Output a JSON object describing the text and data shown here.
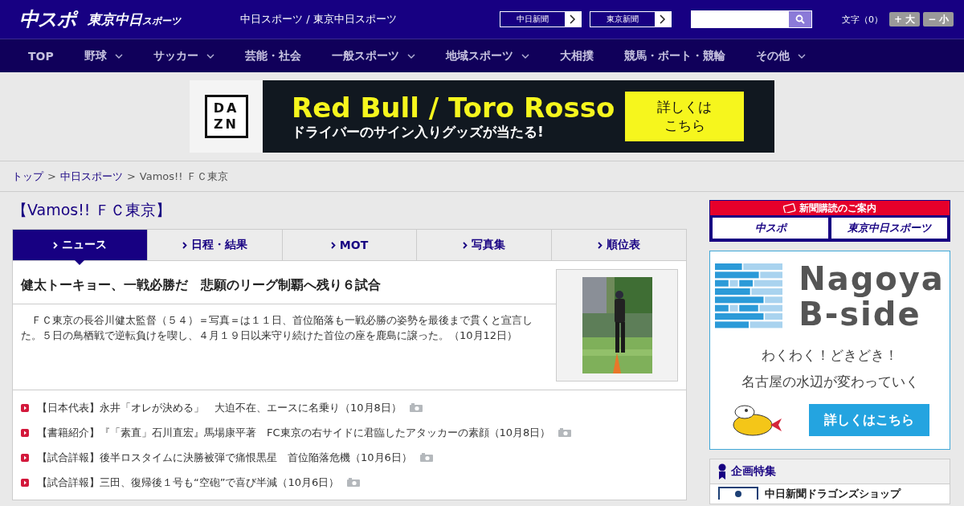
{
  "header": {
    "logo": "中スポ",
    "logo2": "東京中日",
    "logo2_small": "スポーツ",
    "site_title": "中日スポーツ / 東京中日スポーツ",
    "paper_links": [
      {
        "label": "中日新聞"
      },
      {
        "label": "東京新聞"
      }
    ],
    "font_size": {
      "label": "文字（0）",
      "buttons": [
        "+ 大",
        "− 小"
      ]
    }
  },
  "nav": [
    {
      "label": "TOP",
      "has_menu": false
    },
    {
      "label": "野球",
      "has_menu": true
    },
    {
      "label": "サッカー",
      "has_menu": true
    },
    {
      "label": "芸能・社会",
      "has_menu": false
    },
    {
      "label": "一般スポーツ",
      "has_menu": true
    },
    {
      "label": "地域スポーツ",
      "has_menu": true
    },
    {
      "label": "大相撲",
      "has_menu": false
    },
    {
      "label": "競馬・ボート・競輪",
      "has_menu": false
    },
    {
      "label": "その他",
      "has_menu": true
    }
  ],
  "ad_banner": {
    "logo_lines": [
      "DA",
      "ZN"
    ],
    "headline": "Red Bull / Toro Rosso",
    "subline": "ドライバーのサイン入りグッズが当たる!",
    "cta_lines": [
      "詳しくは",
      "こちら"
    ]
  },
  "breadcrumb": [
    {
      "kind": "link",
      "label": "トップ"
    },
    {
      "kind": "separator",
      "label": ">"
    },
    {
      "kind": "link",
      "label": "中日スポーツ"
    },
    {
      "kind": "separator",
      "label": ">"
    },
    {
      "kind": "current",
      "label": "Vamos!!  ＦＣ東京"
    }
  ],
  "page_title": "【Vamos!!  ＦＣ東京】",
  "tabs": [
    {
      "label": "ニュース",
      "selected": true
    },
    {
      "label": "日程・結果",
      "selected": false
    },
    {
      "label": "MOT",
      "selected": false
    },
    {
      "label": "写真集",
      "selected": false
    },
    {
      "label": "順位表",
      "selected": false
    }
  ],
  "article": {
    "headline": "健太トーキョー、一戦必勝だ　悲願のリーグ制覇へ残り６試合",
    "body": "　ＦＣ東京の長谷川健太監督（５４）＝写真＝は１１日、首位陥落も一戦必勝の姿勢を最後まで貫くと宣言した。５日の鳥栖戦で逆転負けを喫し、４月１９日以来守り続けた首位の座を鹿島に譲った。（10月12日）"
  },
  "related": [
    {
      "text": "【日本代表】永井「オレが決める」　大迫不在、エースに名乗り（10月8日）",
      "has_photo": true
    },
    {
      "text": "【書籍紹介】『「素直」石川直宏』馬場康平著　FC東京の右サイドに君臨したアタッカーの素顔（10月8日）",
      "has_photo": true
    },
    {
      "text": "【試合詳報】後半ロスタイムに決勝被弾で痛恨黒星　首位陥落危機（10月6日）",
      "has_photo": true
    },
    {
      "text": "【試合詳報】三田、復帰後１号も“空砲”で喜び半減（10月6日）",
      "has_photo": true
    }
  ],
  "sidebar": {
    "subscription": {
      "title": "新聞購読のご案内",
      "buttons": [
        "中スポ",
        "東京中日スポーツ"
      ]
    },
    "promo": {
      "title_lines": [
        "Nagoya",
        "B-side"
      ],
      "tagline_lines": [
        "わくわく！どきどき！",
        "名古屋の水辺が変わっていく"
      ],
      "cta": "詳しくはこちら"
    },
    "feature": {
      "title": "企画特集",
      "items": [
        "中日新聞ドラゴンズショップ"
      ]
    }
  }
}
